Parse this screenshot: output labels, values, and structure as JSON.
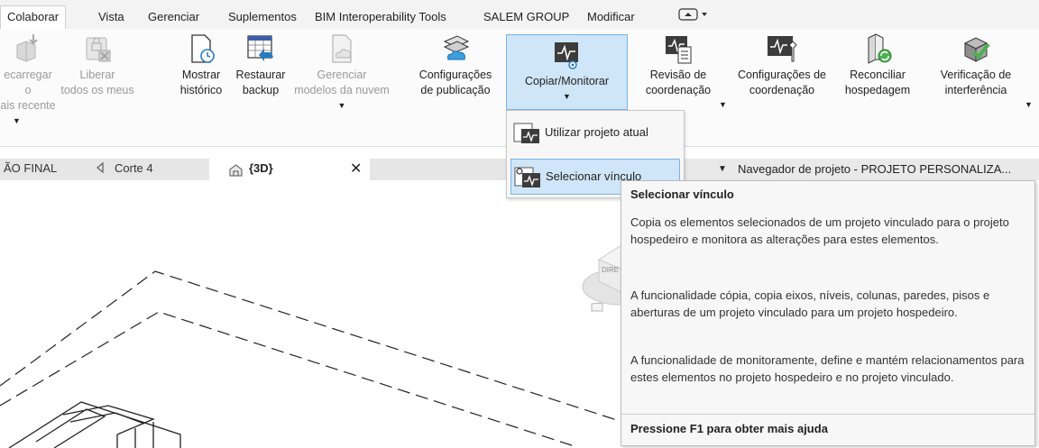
{
  "menu_tabs": [
    "Colaborar",
    "Vista",
    "Gerenciar",
    "Suplementos",
    "BIM Interoperability Tools",
    "SALEM GROUP",
    "Modificar"
  ],
  "ribbon": {
    "recarregar": {
      "line1": "ecarregar o",
      "line2": "ais recente"
    },
    "liberar": {
      "line1": "Liberar",
      "line2": "todos os meus"
    },
    "mostrar": {
      "line1": "Mostrar",
      "line2": "histórico"
    },
    "restaurar": {
      "line1": "Restaurar",
      "line2": "backup"
    },
    "gerenciar": {
      "line1": "Gerenciar",
      "line2": "modelos da nuvem"
    },
    "configuracoes_pub": {
      "line1": "Configurações",
      "line2": "de publicação"
    },
    "copiar_monitorar": {
      "line1": "Copiar/Monitorar"
    },
    "revisao": {
      "line1": "Revisão de",
      "line2": "coordenação"
    },
    "config_coord": {
      "line1": "Configurações de",
      "line2": "coordenação"
    },
    "reconciliar": {
      "line1": "Reconciliar",
      "line2": "hospedagem"
    },
    "verificacao": {
      "line1": "Verificação de",
      "line2": "interferência"
    }
  },
  "view_tabs": {
    "final": "ÃO FINAL",
    "corte": "Corte 4",
    "view3d": "{3D}",
    "close_glyph": "✕"
  },
  "navigator": {
    "label": "Navegador de projeto - PROJETO PERSONALIZA..."
  },
  "dropdown": {
    "item1": "Utilizar projeto atual",
    "item2": "Selecionar vínculo"
  },
  "tooltip": {
    "title": "Selecionar vínculo",
    "p1": "Copia os elementos selecionados de um projeto vinculado para o projeto hospedeiro e monitora as alterações para estes elementos.",
    "p2": "A funcionalidade cópia, copia eixos, níveis, colunas, paredes, pisos e aberturas de um projeto vinculado para um projeto hospedeiro.",
    "p3": "A funcionalidade de monitoramente, define e mantém relacionamentos para estes elementos no projeto hospedeiro e no projeto vinculado.",
    "footer": "Pressione F1 para obter mais ajuda"
  },
  "canvas": {
    "viewcube_label": "DIRE"
  },
  "colors": {
    "accent_blue": "#cfe6f9",
    "accent_border": "#7ab3e3",
    "icon_dark": "#3c3c3c",
    "icon_green": "#4caf50"
  }
}
